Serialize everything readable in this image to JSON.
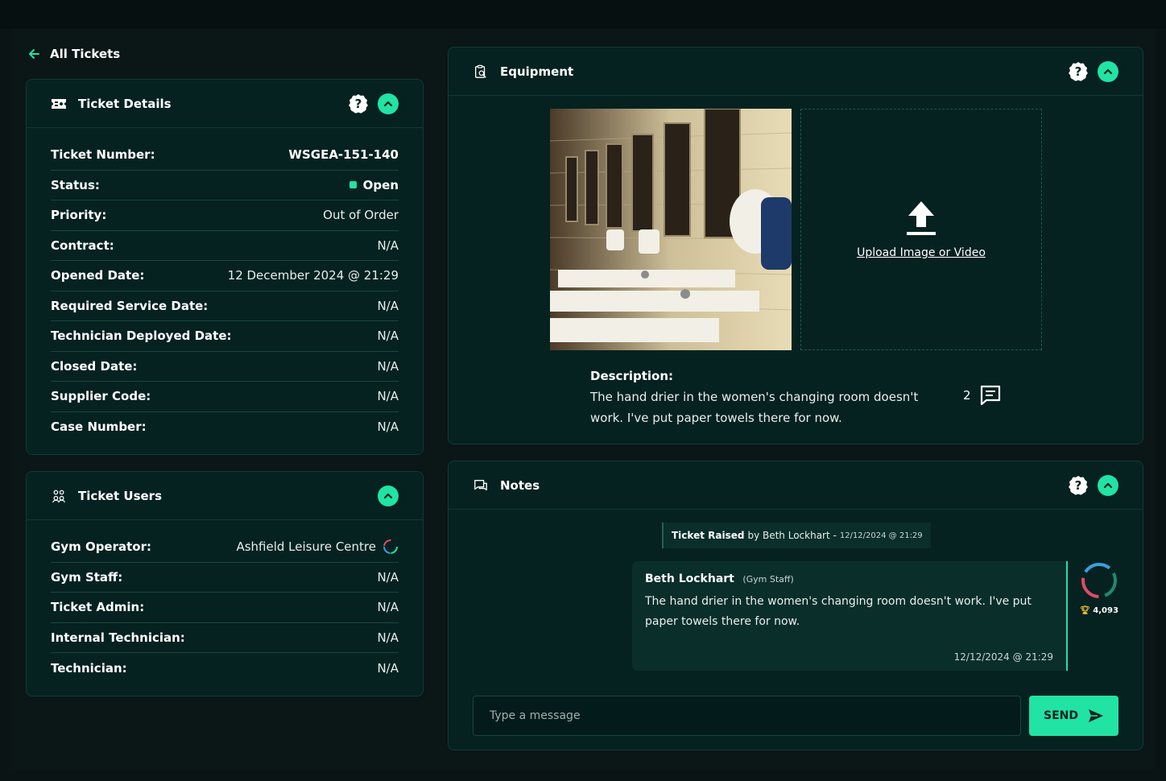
{
  "nav": {
    "back_label": "All Tickets"
  },
  "ticket_details": {
    "title": "Ticket Details",
    "help": "?",
    "rows": [
      {
        "label": "Ticket Number:",
        "value": "WSGEA-151-140"
      },
      {
        "label": "Status:",
        "value": "Open"
      },
      {
        "label": "Priority:",
        "value": "Out of Order"
      },
      {
        "label": "Contract:",
        "value": "N/A"
      },
      {
        "label": "Opened Date:",
        "value": "12 December 2024 @ 21:29"
      },
      {
        "label": "Required Service Date:",
        "value": "N/A"
      },
      {
        "label": "Technician Deployed Date:",
        "value": "N/A"
      },
      {
        "label": "Closed Date:",
        "value": "N/A"
      },
      {
        "label": "Supplier Code:",
        "value": "N/A"
      },
      {
        "label": "Case Number:",
        "value": "N/A"
      }
    ]
  },
  "ticket_users": {
    "title": "Ticket Users",
    "rows": [
      {
        "label": "Gym Operator:",
        "value": "Ashfield Leisure Centre"
      },
      {
        "label": "Gym Staff:",
        "value": "N/A"
      },
      {
        "label": "Ticket Admin:",
        "value": "N/A"
      },
      {
        "label": "Internal Technician:",
        "value": "N/A"
      },
      {
        "label": "Technician:",
        "value": "N/A"
      }
    ]
  },
  "equipment": {
    "title": "Equipment",
    "help": "?",
    "upload_label": "Upload Image or Video",
    "description_label": "Description:",
    "description": "The hand drier in the women's changing room doesn't work. I've put paper towels there for now.",
    "comment_count": "2"
  },
  "notes": {
    "title": "Notes",
    "help": "?",
    "raised": {
      "label": "Ticket Raised",
      "by": "by Beth Lockhart -",
      "time": "12/12/2024 @ 21:29"
    },
    "message": {
      "author": "Beth Lockhart",
      "role": "(Gym Staff)",
      "text": "The hand drier in the women's changing room doesn't work. I've put paper towels there for now.",
      "time": "12/12/2024 @ 21:29",
      "points": "4,093"
    },
    "composer": {
      "placeholder": "Type a message",
      "send_label": "SEND"
    }
  },
  "colors": {
    "accent": "#20e3a4",
    "panel": "#052220",
    "background": "#0a1414"
  }
}
